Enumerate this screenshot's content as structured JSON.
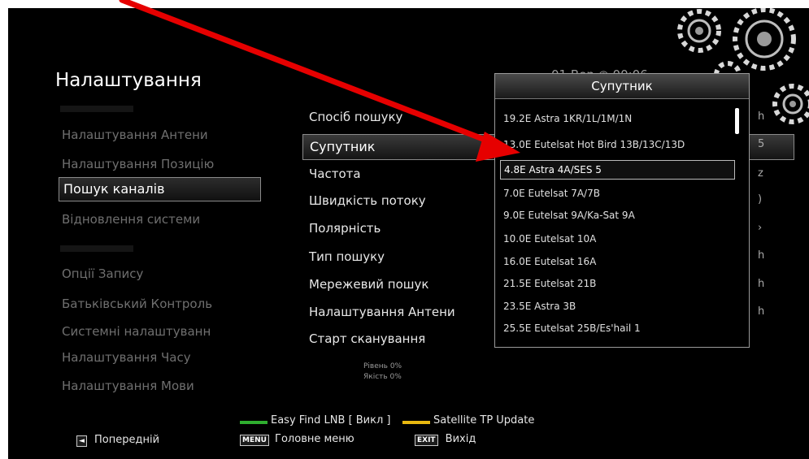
{
  "header": {
    "title": "Налаштування",
    "datetime": "01 Вер ◉ 00:06"
  },
  "sidebar": {
    "items": [
      {
        "label": "Налаштування Антени"
      },
      {
        "label": "Налаштування Позицію"
      },
      {
        "label": "Пошук каналів"
      },
      {
        "label": "Відновлення системи"
      },
      {
        "label": "Опції Запису"
      },
      {
        "label": "Батьківський Контроль"
      },
      {
        "label": "Системні налаштуванн"
      },
      {
        "label": "Налаштування Часу"
      },
      {
        "label": "Налаштування Мови"
      }
    ]
  },
  "options": {
    "items": [
      {
        "label": "Спосіб пошуку"
      },
      {
        "label": "Супутник"
      },
      {
        "label": "Частота"
      },
      {
        "label": "Швидкість потоку"
      },
      {
        "label": "Полярність"
      },
      {
        "label": "Тип пошуку"
      },
      {
        "label": "Мережевий пошук"
      },
      {
        "label": "Налаштування Антени"
      },
      {
        "label": "Старт сканування"
      }
    ],
    "edge_values": [
      "h",
      "5",
      "z",
      ")",
      "›",
      "h",
      "h",
      "h"
    ]
  },
  "signal": {
    "level": "Рівень 0%",
    "quality": "Якість 0%"
  },
  "popup": {
    "title": "Супутник",
    "items": [
      "19.2E Astra 1KR/1L/1M/1N",
      "13.0E Eutelsat Hot Bird 13B/13C/13D",
      "4.8E Astra 4A/SES 5",
      "7.0E Eutelsat 7A/7B",
      "9.0E Eutelsat 9A/Ka-Sat 9A",
      "10.0E Eutelsat 10A",
      "16.0E Eutelsat 16A",
      "21.5E Eutelsat 21B",
      "23.5E Astra 3B",
      "25.5E Eutelsat 25B/Es'hail 1"
    ],
    "selected_index": 2
  },
  "footer": {
    "green_label": "Easy Find LNB [ Викл ]",
    "yellow_label": "Satellite TP Update",
    "back_label": "Попередній",
    "menu_key": "MENU",
    "menu_label": "Головне меню",
    "exit_key": "EXIT",
    "exit_label": "Вихід"
  },
  "colors": {
    "green_key": "#2fae2f",
    "yellow_key": "#e8b810",
    "arrow": "#e60000"
  }
}
